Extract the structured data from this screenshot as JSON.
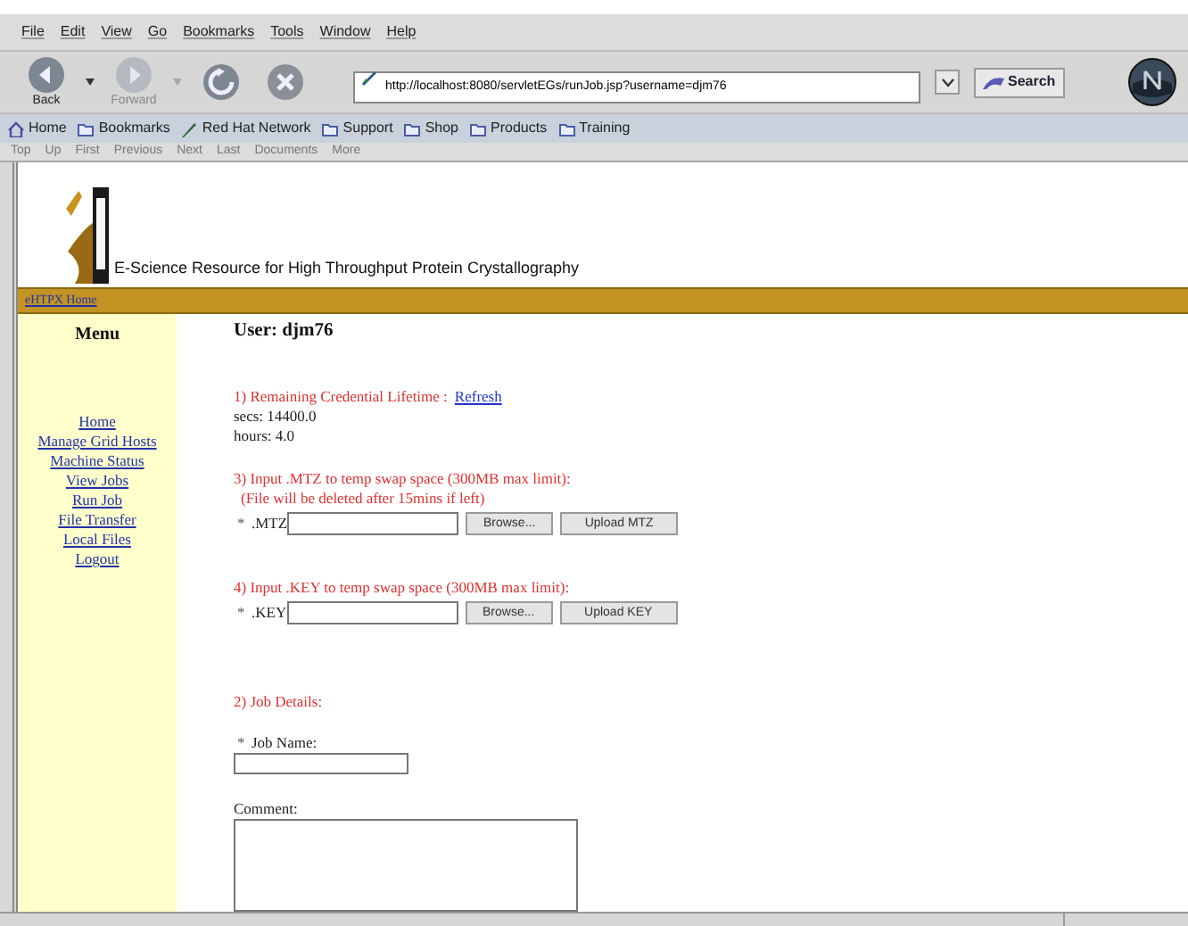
{
  "menu_bar": [
    "File",
    "Edit",
    "View",
    "Go",
    "Bookmarks",
    "Tools",
    "Window",
    "Help"
  ],
  "nav_buttons": [
    {
      "kind": "back",
      "label": "Back",
      "disabled": false
    },
    {
      "kind": "forward",
      "label": "Forward",
      "disabled": true
    },
    {
      "kind": "reload"
    },
    {
      "kind": "stop"
    }
  ],
  "address": {
    "value": "http://localhost:8080/servletEGs/runJob.jsp?username=djm76"
  },
  "search_button": "Search",
  "personal_toolbar": [
    {
      "kind": "home",
      "label": "Home"
    },
    {
      "kind": "folder",
      "label": "Bookmarks"
    },
    {
      "kind": "redhat",
      "label": "Red Hat Network"
    },
    {
      "kind": "folder",
      "label": "Support"
    },
    {
      "kind": "folder",
      "label": "Shop"
    },
    {
      "kind": "folder",
      "label": "Products"
    },
    {
      "kind": "folder",
      "label": "Training"
    }
  ],
  "site_nav": [
    {
      "label": "Top",
      "disabled": true
    },
    {
      "label": "Up",
      "disabled": true
    },
    {
      "label": "First",
      "disabled": true
    },
    {
      "label": "Previous",
      "disabled": true
    },
    {
      "label": "Next",
      "disabled": true
    },
    {
      "label": "Last",
      "disabled": true
    },
    {
      "label": "Documents",
      "disabled": true
    },
    {
      "label": "More",
      "disabled": true
    }
  ],
  "page": {
    "tagline": "E-Science Resource for High Throughput Protein Crystallography",
    "home_link": "eHTPX Home",
    "sidebar": {
      "title": "Menu",
      "items": [
        "Home",
        "Manage Grid Hosts",
        "Machine Status",
        "View Jobs",
        "Run Job",
        "File Transfer",
        "Local Files",
        "Logout"
      ]
    },
    "user_heading": "User: djm76",
    "credential": {
      "heading": "1) Remaining Credential Lifetime :",
      "refresh_link": "Refresh",
      "lines": [
        "secs: 14400.0",
        "hours: 4.0"
      ]
    },
    "uploads": [
      {
        "heading": "3) Input .MTZ to temp swap space (300MB max limit):",
        "note": "(File will be deleted after 15mins if left)",
        "bullet": "*",
        "label": ".MTZ",
        "browse": "Browse...",
        "upload": "Upload MTZ"
      },
      {
        "heading": "4) Input .KEY to temp swap space (300MB max limit):",
        "bullet": "*",
        "label": ".KEY",
        "browse": "Browse...",
        "upload": "Upload KEY"
      }
    ],
    "job": {
      "heading": "2) Job Details:",
      "bullet": "*",
      "name_label": "Job Name:",
      "comment_label": "Comment:"
    }
  }
}
